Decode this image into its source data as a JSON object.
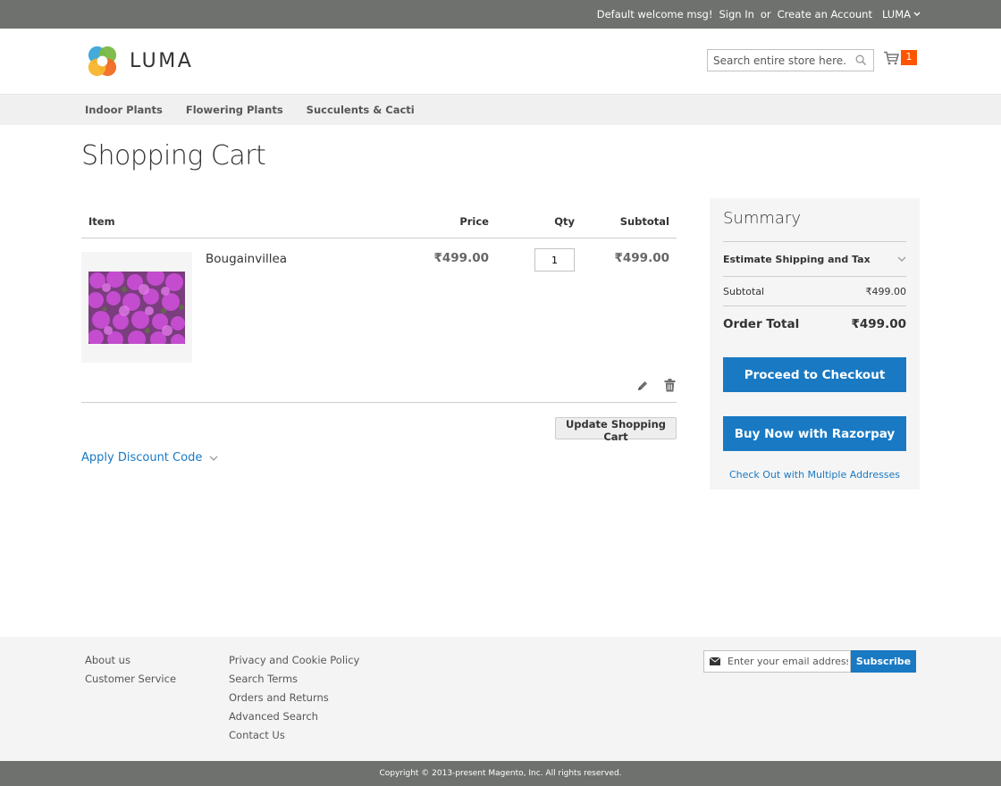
{
  "top_panel": {
    "welcome": "Default welcome msg!",
    "sign_in": "Sign In",
    "or": "or",
    "create_account": "Create an Account",
    "switcher": "LUMA"
  },
  "header": {
    "logo_text": "LUMA",
    "search_placeholder": "Search entire store here...",
    "cart_count": "1"
  },
  "nav": {
    "items": [
      "Indoor Plants",
      "Flowering Plants",
      "Succulents & Cacti"
    ]
  },
  "page": {
    "title": "Shopping Cart"
  },
  "cart": {
    "headers": {
      "item": "Item",
      "price": "Price",
      "qty": "Qty",
      "subtotal": "Subtotal"
    },
    "items": [
      {
        "name": "Bougainvillea",
        "price": "₹499.00",
        "qty": "1",
        "subtotal": "₹499.00"
      }
    ],
    "update_button": "Update Shopping Cart",
    "discount_label": "Apply Discount Code"
  },
  "summary": {
    "title": "Summary",
    "estimate": "Estimate Shipping and Tax",
    "subtotal_label": "Subtotal",
    "subtotal_value": "₹499.00",
    "total_label": "Order Total",
    "total_value": "₹499.00",
    "checkout_button": "Proceed to Checkout",
    "razorpay_button": "Buy Now with Razorpay",
    "multi_address": "Check Out with Multiple Addresses"
  },
  "footer": {
    "col1": [
      "About us",
      "Customer Service"
    ],
    "col2": [
      "Privacy and Cookie Policy",
      "Search Terms",
      "Orders and Returns",
      "Advanced Search",
      "Contact Us"
    ],
    "newsletter_placeholder": "Enter your email address",
    "subscribe": "Subscribe",
    "copyright": "Copyright © 2013-present Magento, Inc. All rights reserved."
  },
  "colors": {
    "accent": "#1979c3",
    "cart_badge": "#ff5501",
    "panel": "#6e716e"
  }
}
